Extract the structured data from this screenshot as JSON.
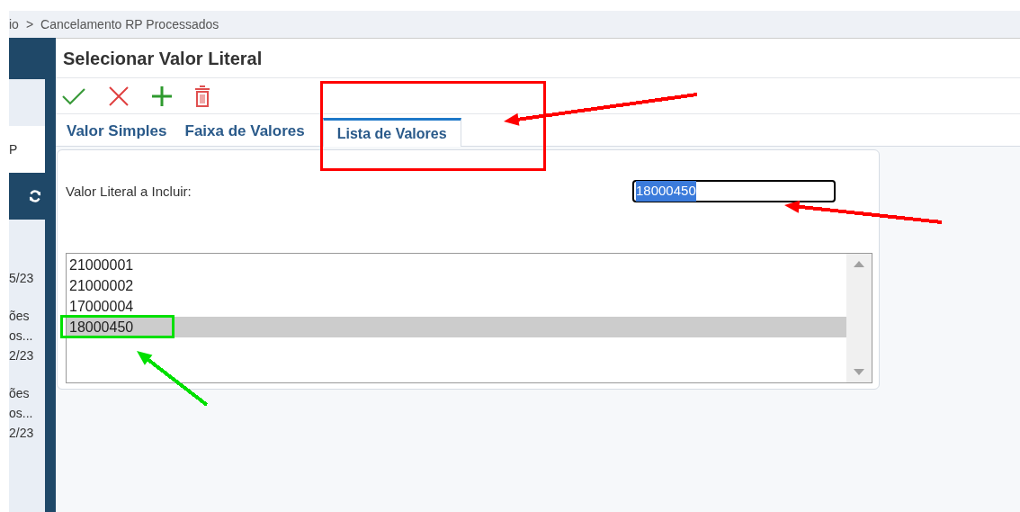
{
  "breadcrumb": {
    "items": [
      "io",
      "Cancelamento RP Processados"
    ],
    "separator": ">"
  },
  "sidebar": {
    "texts": [
      "P",
      "5/23",
      "ões",
      "os...",
      "2/23",
      "ões",
      "os...",
      "2/23"
    ]
  },
  "dialog": {
    "title": "Selecionar Valor Literal",
    "toolbar": [
      {
        "kind": "confirm"
      },
      {
        "kind": "cancel"
      },
      {
        "kind": "add"
      },
      {
        "kind": "delete"
      }
    ],
    "tabs": [
      {
        "label": "Valor Simples",
        "selected": false
      },
      {
        "label": "Faixa de Valores",
        "selected": false
      },
      {
        "label": "Lista de Valores",
        "selected": true
      }
    ],
    "field": {
      "label": "Valor Literal a Incluir:",
      "value": "18000450",
      "highlighted": true
    },
    "list": [
      {
        "value": "21000001",
        "selected": false
      },
      {
        "value": "21000002",
        "selected": false
      },
      {
        "value": "17000004",
        "selected": false
      },
      {
        "value": "18000450",
        "selected": true
      }
    ]
  },
  "annotations": [
    {
      "kind": "box",
      "color": "#ff0000"
    },
    {
      "kind": "arrow",
      "color": "#ff0000"
    },
    {
      "kind": "arrow",
      "color": "#ff0000"
    },
    {
      "kind": "box",
      "color": "#00e000"
    },
    {
      "kind": "arrow",
      "color": "#00e000"
    }
  ]
}
